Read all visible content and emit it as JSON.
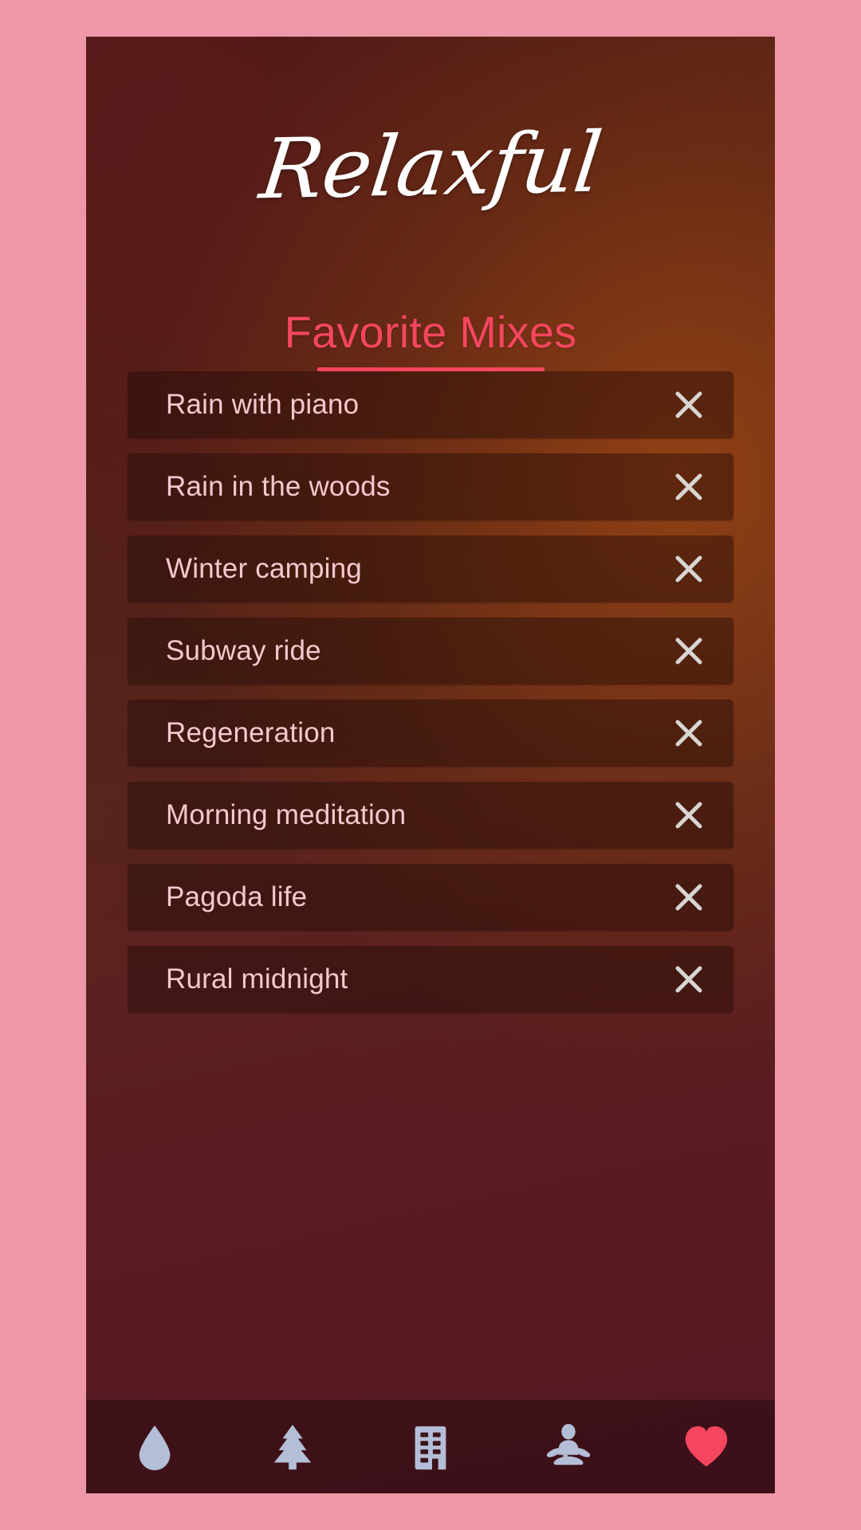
{
  "app": {
    "brand": "Relaxful"
  },
  "section": {
    "title": "Favorite Mixes"
  },
  "favorites": {
    "remove_label": "×",
    "items": [
      {
        "name": "Rain with piano"
      },
      {
        "name": "Rain in the woods"
      },
      {
        "name": "Winter camping"
      },
      {
        "name": "Subway ride"
      },
      {
        "name": "Regeneration"
      },
      {
        "name": "Morning meditation"
      },
      {
        "name": "Pagoda life"
      },
      {
        "name": "Rural midnight"
      }
    ]
  },
  "bottom_nav": {
    "items": [
      {
        "icon": "water-drop-icon",
        "label": "Rain",
        "active": false
      },
      {
        "icon": "pine-tree-icon",
        "label": "Nature",
        "active": false
      },
      {
        "icon": "building-icon",
        "label": "City",
        "active": false
      },
      {
        "icon": "meditation-icon",
        "label": "Meditation",
        "active": false
      },
      {
        "icon": "heart-icon",
        "label": "Favorites",
        "active": true
      }
    ]
  },
  "colors": {
    "page_background": "#ee97a8",
    "screen_top": "#4e1a17",
    "screen_mid": "#5c2a1c",
    "screen_bottom": "#551823",
    "accent": "#f4465f",
    "item_text": "#f6c8ce",
    "item_background": "rgba(34,10,6,0.46)",
    "nav_icon": "#b4bed6",
    "nav_icon_active": "#f4465f",
    "close_icon": "#d8d5d2",
    "brand_text": "#ffffff"
  }
}
